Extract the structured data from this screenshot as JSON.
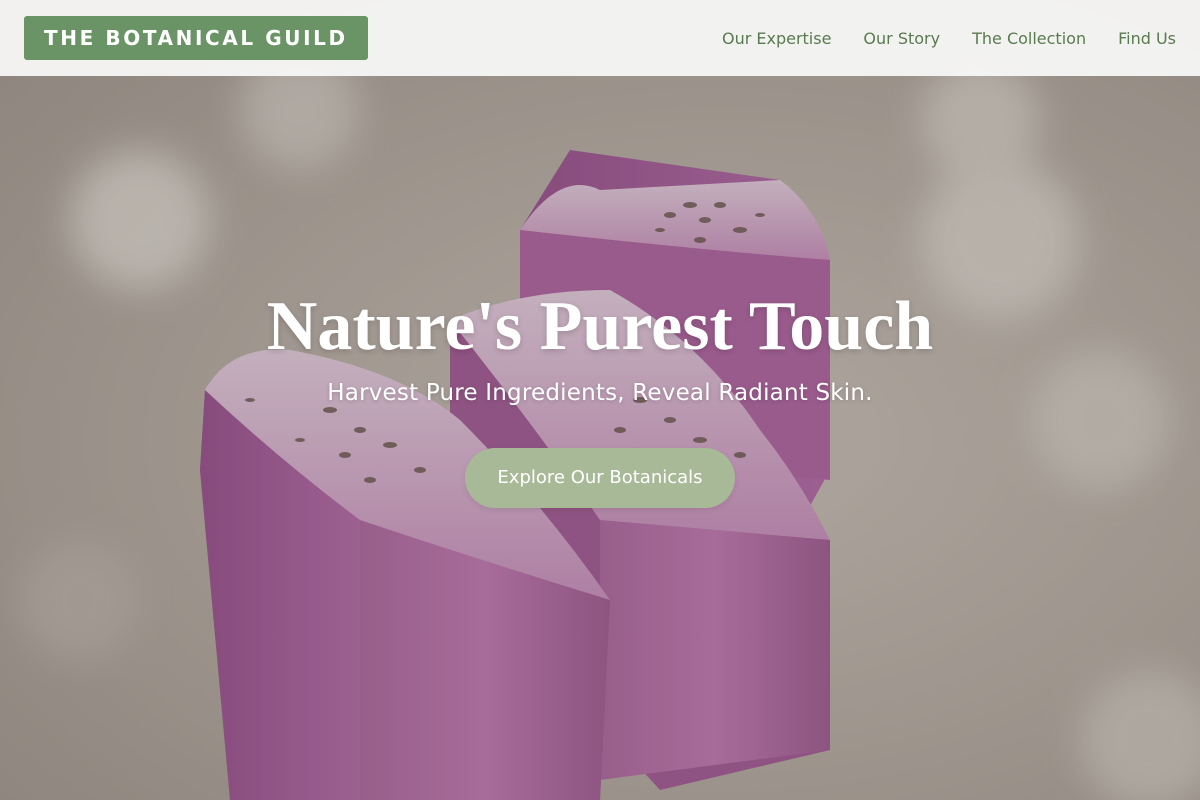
{
  "brand": {
    "name": "THE BOTANICAL GUILD",
    "accent_color": "#6b9466"
  },
  "nav": {
    "items": [
      {
        "label": "Our Expertise"
      },
      {
        "label": "Our Story"
      },
      {
        "label": "The Collection"
      },
      {
        "label": "Find Us"
      }
    ],
    "link_color": "#5a7a4f"
  },
  "hero": {
    "title": "Nature's Purest Touch",
    "subtitle": "Harvest Pure Ingredients, Reveal Radiant Skin.",
    "cta_label": "Explore Our Botanicals",
    "cta_color": "#a8b998",
    "image_subject": "lavender-soap-bars"
  }
}
